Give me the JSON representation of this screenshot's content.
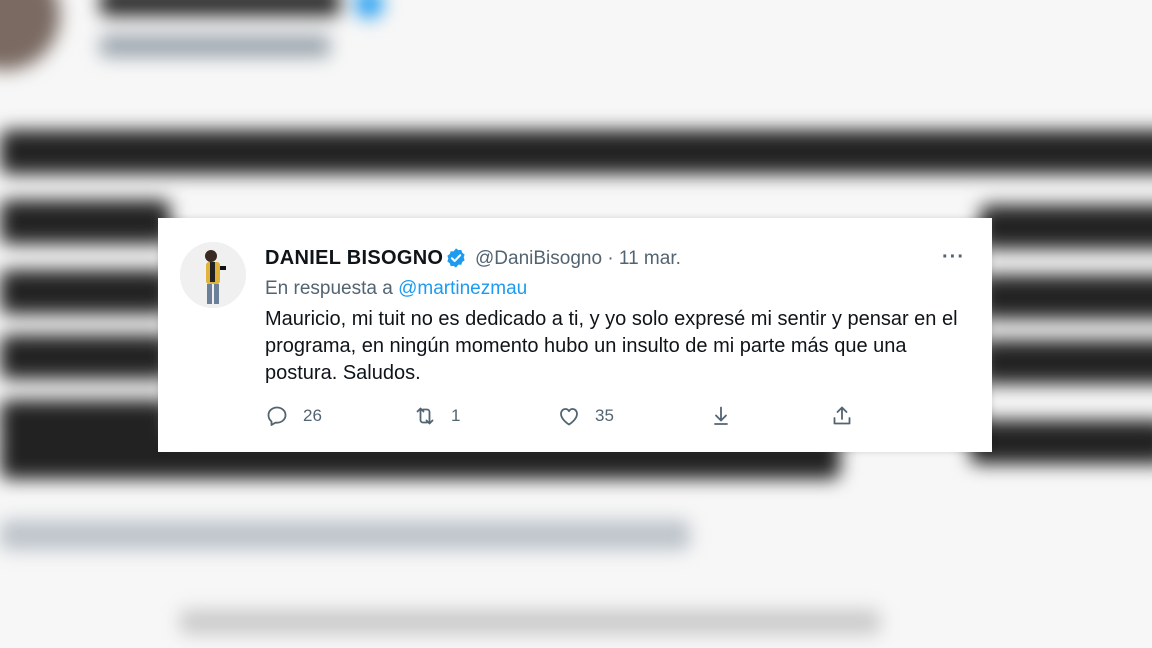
{
  "tweet": {
    "name": "DANIEL BISOGNO",
    "handle": "@DaniBisogno",
    "separator": "·",
    "date": "11 mar.",
    "reply_prefix": "En respuesta a",
    "reply_mention": "@martinezmau",
    "text": "Mauricio, mi tuit no es dedicado a ti, y yo solo expresé mi sentir y pensar en el programa, en ningún momento hubo un insulto de mi parte más que una postura. Saludos.",
    "more_label": "···",
    "actions": {
      "replies": "26",
      "retweets": "1",
      "likes": "35"
    }
  },
  "colors": {
    "accent": "#1d9bf0",
    "text": "#0f1419",
    "secondary": "#536471"
  },
  "icons": [
    "verified-badge-icon",
    "more-icon",
    "reply-icon",
    "retweet-icon",
    "like-icon",
    "download-icon",
    "share-icon"
  ]
}
